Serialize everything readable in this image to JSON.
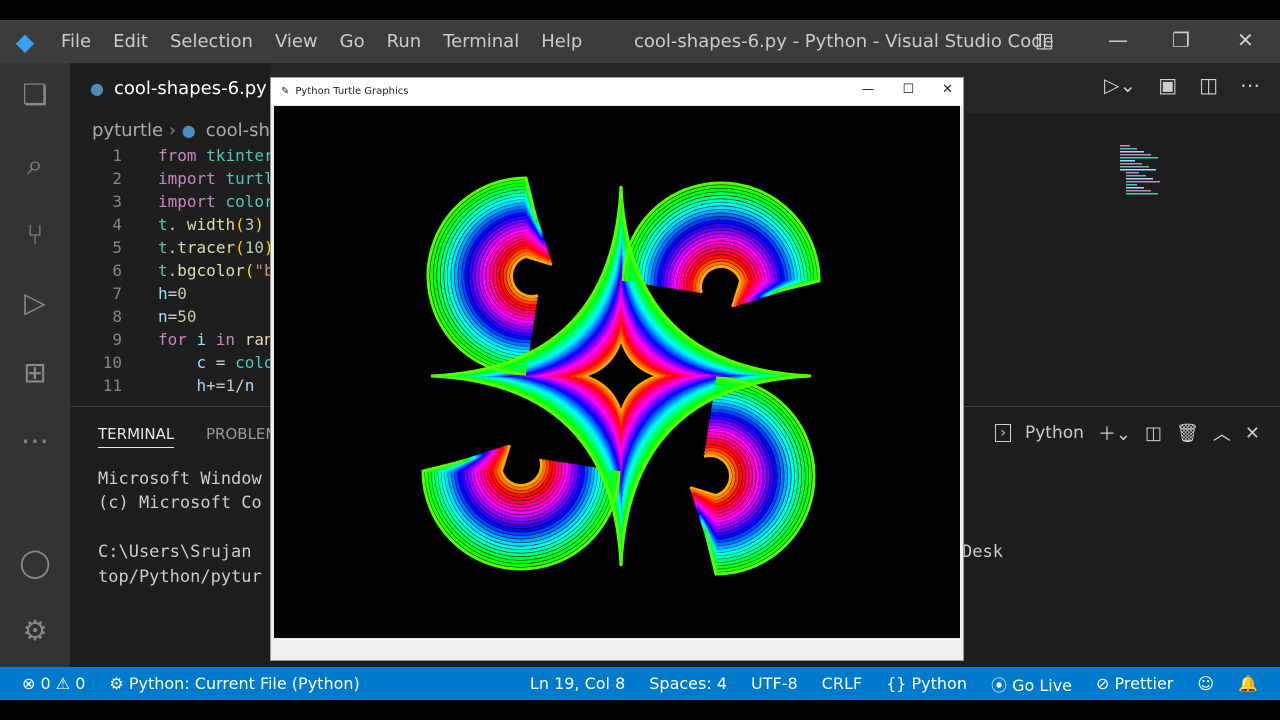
{
  "titlebar": {
    "menu": [
      "File",
      "Edit",
      "Selection",
      "View",
      "Go",
      "Run",
      "Terminal",
      "Help"
    ],
    "title": "cool-shapes-6.py - Python - Visual Studio Code"
  },
  "tab": {
    "label": "cool-shapes-6.py"
  },
  "breadcrumb": {
    "folder": "pyturtle",
    "file": "cool-sh"
  },
  "code": [
    {
      "n": "1",
      "parts": [
        [
          "kw",
          "from "
        ],
        [
          "mod",
          "tkinter"
        ]
      ]
    },
    {
      "n": "2",
      "parts": [
        [
          "kw",
          "import "
        ],
        [
          "mod",
          "turtl"
        ]
      ]
    },
    {
      "n": "3",
      "parts": [
        [
          "kw",
          "import "
        ],
        [
          "mod",
          "color"
        ]
      ]
    },
    {
      "n": "4",
      "parts": [
        [
          "mod",
          "t"
        ],
        [
          "",
          ". "
        ],
        [
          "fn",
          "width"
        ],
        [
          "par",
          "("
        ],
        [
          "nm",
          "3"
        ],
        [
          "par",
          ")"
        ]
      ]
    },
    {
      "n": "5",
      "parts": [
        [
          "mod",
          "t"
        ],
        [
          "",
          "."
        ],
        [
          "fn",
          "tracer"
        ],
        [
          "par",
          "("
        ],
        [
          "nm",
          "10"
        ],
        [
          "par",
          ")"
        ]
      ]
    },
    {
      "n": "6",
      "parts": [
        [
          "mod",
          "t"
        ],
        [
          "",
          "."
        ],
        [
          "fn",
          "bgcolor"
        ],
        [
          "par",
          "("
        ],
        [
          "str",
          "\"b"
        ]
      ]
    },
    {
      "n": "7",
      "parts": [
        [
          "var",
          "h"
        ],
        [
          "",
          "="
        ],
        [
          "nm",
          "0"
        ]
      ]
    },
    {
      "n": "8",
      "parts": [
        [
          "var",
          "n"
        ],
        [
          "",
          "="
        ],
        [
          "nm",
          "50"
        ]
      ]
    },
    {
      "n": "9",
      "parts": [
        [
          "kw",
          "for "
        ],
        [
          "var",
          "i "
        ],
        [
          "kw",
          "in "
        ],
        [
          "fn",
          "ran"
        ]
      ]
    },
    {
      "n": "10",
      "parts": [
        [
          "",
          "    "
        ],
        [
          "var",
          "c "
        ],
        [
          "",
          "= "
        ],
        [
          "mod",
          "colo"
        ]
      ]
    },
    {
      "n": "11",
      "parts": [
        [
          "",
          "    "
        ],
        [
          "var",
          "h"
        ],
        [
          "",
          "+="
        ],
        [
          "nm",
          "1"
        ],
        [
          "",
          "/"
        ],
        [
          "var",
          "n"
        ]
      ]
    }
  ],
  "panel": {
    "tabs": [
      "TERMINAL",
      "PROBLEM"
    ],
    "terminal": [
      "Microsoft Window",
      "(c) Microsoft Co",
      "",
      "C:\\Users\\Srujan",
      "top/Python/pytur"
    ],
    "terminal_right": "Desk",
    "shell": "Python"
  },
  "turtle": {
    "title": "Python Turtle Graphics"
  },
  "status": {
    "errors": "0",
    "warnings": "0",
    "debug": "Python: Current File (Python)",
    "position": "Ln 19, Col 8",
    "spaces": "Spaces: 4",
    "encoding": "UTF-8",
    "eol": "CRLF",
    "language": "Python",
    "golive": "Go Live",
    "prettier": "Prettier"
  }
}
